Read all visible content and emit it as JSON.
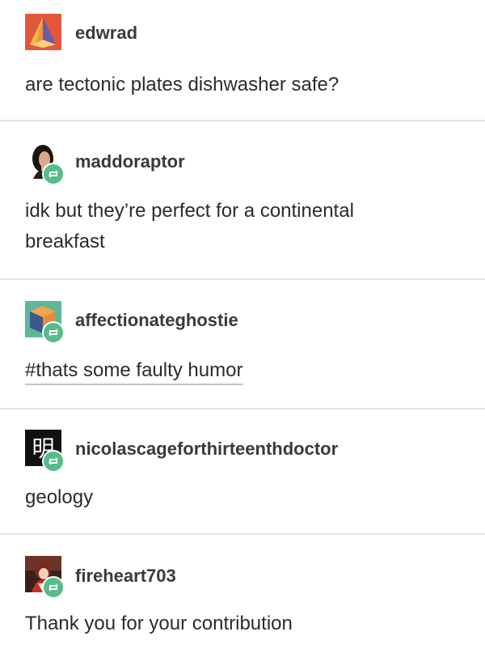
{
  "posts": [
    {
      "username": "edwrad",
      "text": "are tectonic plates dishwasher safe?",
      "avatar_icon": "orange-pyramid-avatar-icon",
      "reblogged": false
    },
    {
      "username": "maddoraptor",
      "text_line1": "idk but they’re perfect for a continental",
      "text_line2": "breakfast",
      "avatar_icon": "woman-portrait-avatar-icon",
      "reblogged": true
    },
    {
      "username": "affectionateghostie",
      "tag": "#thats some faulty humor",
      "avatar_icon": "cube-box-avatar-icon",
      "reblogged": true
    },
    {
      "username": "nicolascageforthirteenthdoctor",
      "text": "geology",
      "avatar_icon": "kanji-avatar-icon",
      "avatar_glyph": "明",
      "reblogged": true
    },
    {
      "username": "fireheart703",
      "text": "Thank you for your contribution",
      "avatar_icon": "anime-character-avatar-icon",
      "reblogged": true
    }
  ],
  "colors": {
    "reblog_badge": "#56bc8a",
    "divider": "#e3e3e3",
    "text": "#2b2b2b",
    "avatar_orange": "#e2573b"
  }
}
